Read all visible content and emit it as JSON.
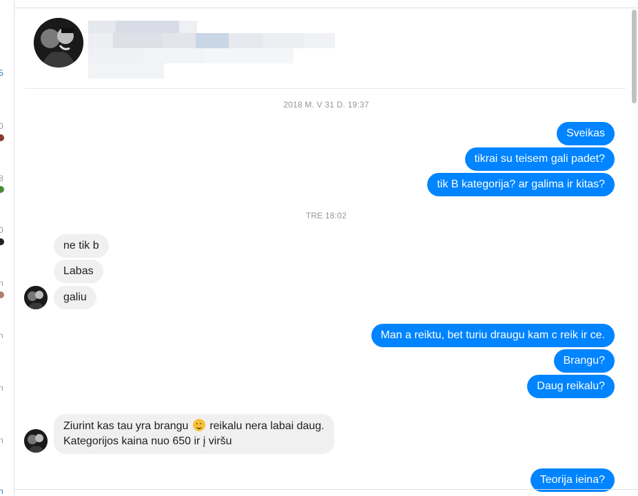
{
  "left_strip": {
    "fragments": [
      "5",
      "0",
      "8",
      "0",
      "n",
      "n",
      "n",
      "n",
      "n"
    ]
  },
  "header": {
    "avatar": "contact-avatar-photo"
  },
  "messages": {
    "sep1": "2018 M. V 31 D. 19:37",
    "out1": "Sveikas",
    "out2": "tikrai su teisem gali padet?",
    "out3": "tik B kategorija? ar galima ir kitas?",
    "sep2": "TRE 18:02",
    "in1": "ne tik b",
    "in2": "Labas",
    "in3": "galiu",
    "out4": "Man a reiktu, bet turiu draugu kam c reik ir ce.",
    "out5": "Brangu?",
    "out6": "Daug reikalu?",
    "in4_before_emoji": "Ziurint kas tau yra brangu",
    "in4_after_emoji": "reikalu nera labai daug.",
    "in4_line2": "Kategorijos kaina nuo 650 ir į viršu",
    "out7": "Teorija ieina?"
  },
  "colors": {
    "outgoing_bubble": "#0084ff",
    "incoming_bubble": "#f1f0f0",
    "timestamp": "#90949c"
  },
  "icons": {
    "emoji": "slightly-smiling-face-emoji"
  }
}
